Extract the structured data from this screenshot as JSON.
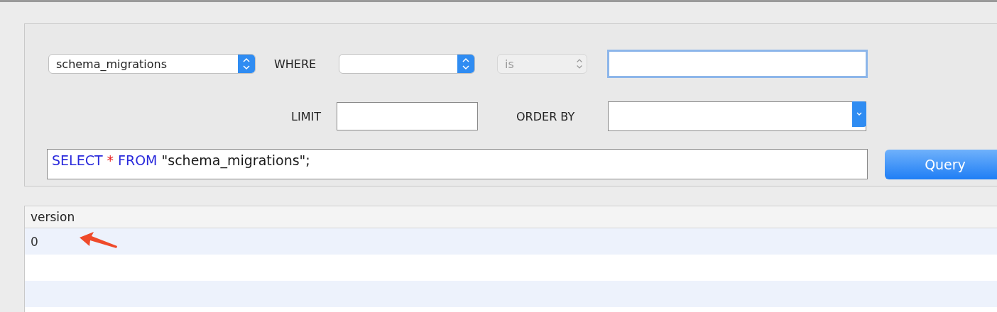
{
  "query_builder": {
    "table_select": {
      "value": "schema_migrations"
    },
    "where_label": "WHERE",
    "where_column_select": {
      "disabled": false
    },
    "operator_select": {
      "value": "is",
      "disabled": true
    },
    "where_value_field": {
      "focused": true
    },
    "limit_label": "LIMIT",
    "limit_field": {
      "focused": false
    },
    "order_by_label": "ORDER BY",
    "order_by_field": {
      "focused": false
    },
    "sql": [
      {
        "kind": "keyword",
        "text": "SELECT"
      },
      {
        "kind": "operator",
        "text": "*"
      },
      {
        "kind": "keyword",
        "text": "FROM"
      },
      {
        "kind": "string",
        "text": "\"schema_migrations\";"
      }
    ],
    "query_button": "Query"
  },
  "results": {
    "columns": [
      "version"
    ],
    "rows": [
      [
        "0"
      ]
    ]
  }
}
